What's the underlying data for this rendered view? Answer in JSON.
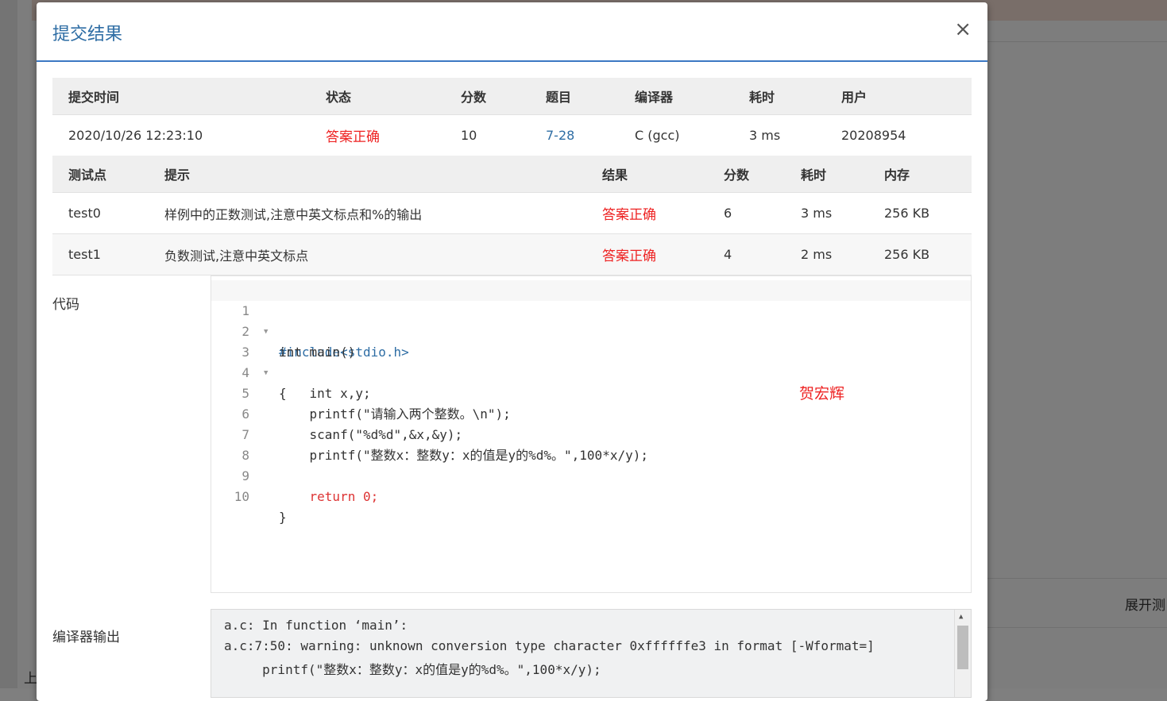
{
  "background": {
    "expand_label": "展开测",
    "bottom_left_char": "上"
  },
  "modal": {
    "title": "提交结果",
    "close_symbol": "×"
  },
  "summary": {
    "headers": [
      "提交时间",
      "状态",
      "分数",
      "题目",
      "编译器",
      "耗时",
      "用户"
    ],
    "row": {
      "time": "2020/10/26 12:23:10",
      "status": "答案正确",
      "score": "10",
      "problem": "7-28",
      "compiler": "C (gcc)",
      "elapsed": "3 ms",
      "user": "20208954"
    }
  },
  "tests": {
    "headers": [
      "测试点",
      "提示",
      "结果",
      "分数",
      "耗时",
      "内存"
    ],
    "rows": [
      {
        "id": "test0",
        "hint": "样例中的正数测试,注意中英文标点和%的输出",
        "result": "答案正确",
        "score": "6",
        "elapsed": "3 ms",
        "memory": "256 KB"
      },
      {
        "id": "test1",
        "hint": "负数测试,注意中英文标点",
        "result": "答案正确",
        "score": "4",
        "elapsed": "2 ms",
        "memory": "256 KB"
      }
    ]
  },
  "code": {
    "label": "代码",
    "watermark": "贺宏辉",
    "line_numbers": [
      "1",
      "2",
      "3",
      "4",
      "5",
      "6",
      "7",
      "8",
      "9",
      "10"
    ],
    "lines": [
      "#include<stdio.h>",
      "int main()",
      "{",
      "    int x,y;",
      "    printf(\"请输入两个整数。\\n\");",
      "    scanf(\"%d%d\",&x,&y);",
      "    printf(\"整数x：整数y：x的值是y的%d%。\",100*x/y);",
      "    ",
      "    return 0;",
      "}"
    ]
  },
  "compiler_output": {
    "label": "编译器输出",
    "lines": [
      "a.c: In function ‘main’:",
      "a.c:7:50: warning: unknown conversion type character 0xffffffe3 in format [-Wformat=]",
      "     printf(\"整数x：整数y：x的值是y的%d%。\",100*x/y);"
    ]
  },
  "colors": {
    "accent": "#3c78c3",
    "title": "#2e6da4",
    "success": "#ee2222"
  }
}
